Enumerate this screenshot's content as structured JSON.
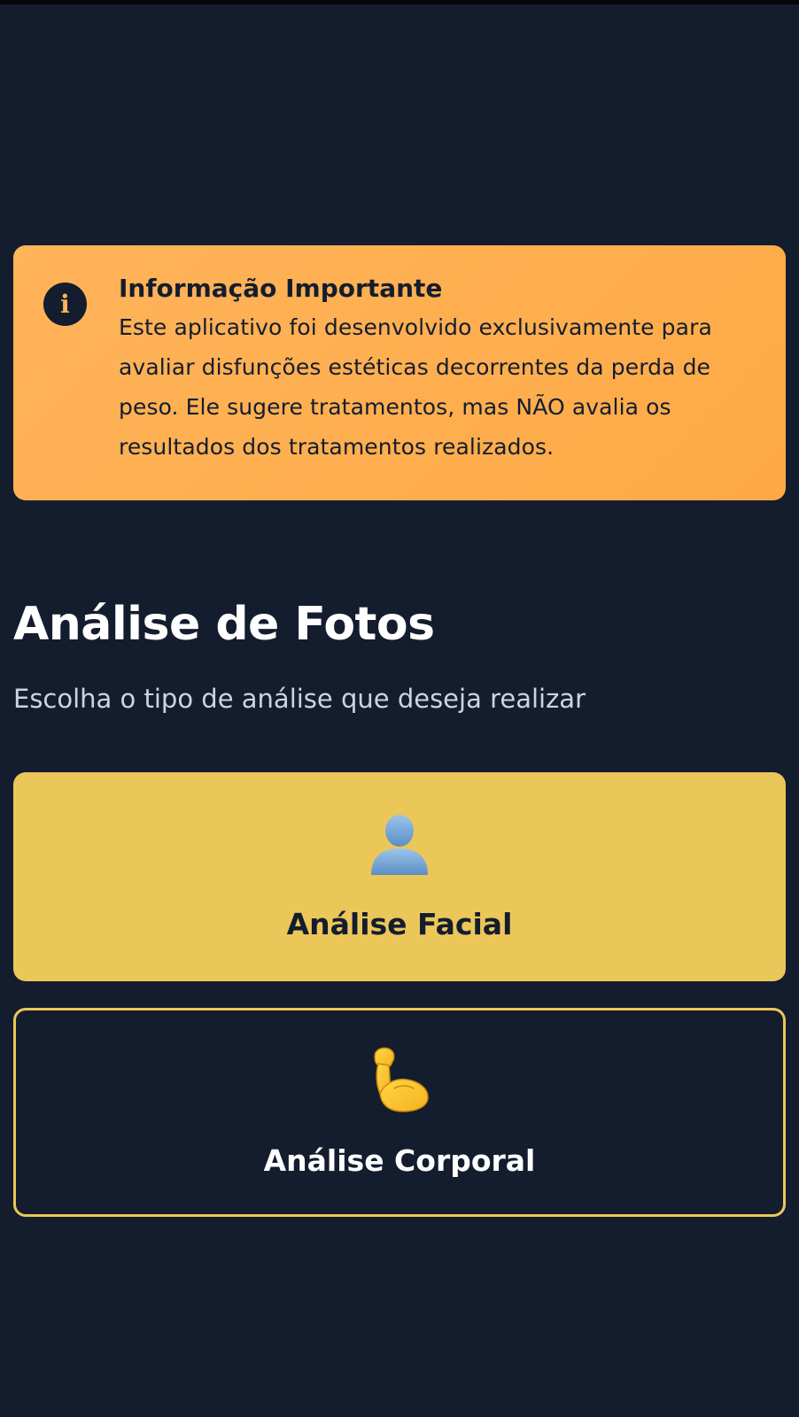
{
  "info": {
    "icon": "info-icon",
    "icon_glyph": "i",
    "title": "Informação Importante",
    "text": "Este aplicativo foi desenvolvido exclusivamente para avaliar disfunções estéticas decorrentes da perda de peso. Ele sugere tratamentos, mas NÃO avalia os resultados dos tratamentos realizados."
  },
  "header": {
    "title": "Análise de Fotos",
    "subtitle": "Escolha o tipo de análise que deseja realizar"
  },
  "options": [
    {
      "label": "Análise Facial",
      "icon": "person-silhouette-icon"
    },
    {
      "label": "Análise Corporal",
      "icon": "flexed-biceps-icon"
    }
  ],
  "colors": {
    "background": "#141d2e",
    "info_card": "#ffb35a",
    "accent": "#ebc659",
    "text_light": "#ffffff",
    "text_muted": "#cbd5e1"
  }
}
